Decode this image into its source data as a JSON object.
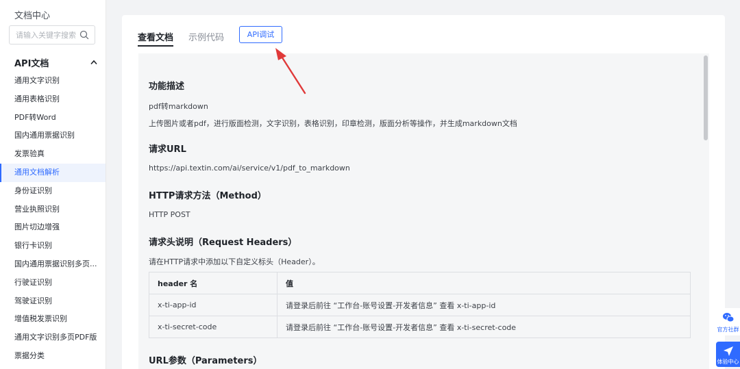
{
  "sidebar": {
    "title": "文档中心",
    "search_placeholder": "请输入关键字搜索",
    "group_label": "API文档",
    "items": [
      {
        "label": "通用文字识别"
      },
      {
        "label": "通用表格识别"
      },
      {
        "label": "PDF转Word"
      },
      {
        "label": "国内通用票据识别"
      },
      {
        "label": "发票验真"
      },
      {
        "label": "通用文档解析",
        "active": true
      },
      {
        "label": "身份证识别"
      },
      {
        "label": "营业执照识别"
      },
      {
        "label": "图片切边增强"
      },
      {
        "label": "银行卡识别"
      },
      {
        "label": "国内通用票据识别多页..."
      },
      {
        "label": "行驶证识别"
      },
      {
        "label": "驾驶证识别"
      },
      {
        "label": "增值税发票识别"
      },
      {
        "label": "通用文字识别多页PDF版"
      },
      {
        "label": "票据分类"
      }
    ]
  },
  "tabs": {
    "view_docs": "查看文档",
    "example_code": "示例代码",
    "api_debug": "API调试"
  },
  "doc": {
    "function_title": "功能描述",
    "function_name": "pdf转markdown",
    "function_desc": "上传图片或者pdf，进行版面检测，文字识别，表格识别，印章检测，版面分析等操作，并生成markdown文档",
    "url_title": "请求URL",
    "url": "https://api.textin.com/ai/service/v1/pdf_to_markdown",
    "method_title": "HTTP请求方法（Method）",
    "method": "HTTP POST",
    "headers_title": "请求头说明（Request Headers）",
    "headers_desc": "请在HTTP请求中添加以下自定义标头（Header）。",
    "headers_table": {
      "columns": [
        "header 名",
        "值"
      ],
      "rows": [
        [
          "x-ti-app-id",
          "请登录后前往 “工作台-账号设置-开发者信息” 查看 x-ti-app-id"
        ],
        [
          "x-ti-secret-code",
          "请登录后前往 “工作台-账号设置-开发者信息” 查看 x-ti-secret-code"
        ]
      ]
    },
    "params_title": "URL参数（Parameters）"
  },
  "floats": {
    "community": "官方社群",
    "experience": "体验中心"
  },
  "colors": {
    "accent": "#2f6bff",
    "arrow": "#e03a3a"
  },
  "icons": {
    "search": "search-icon",
    "chevron": "chevron-up-icon",
    "wechat": "wechat-icon",
    "send": "send-icon"
  }
}
